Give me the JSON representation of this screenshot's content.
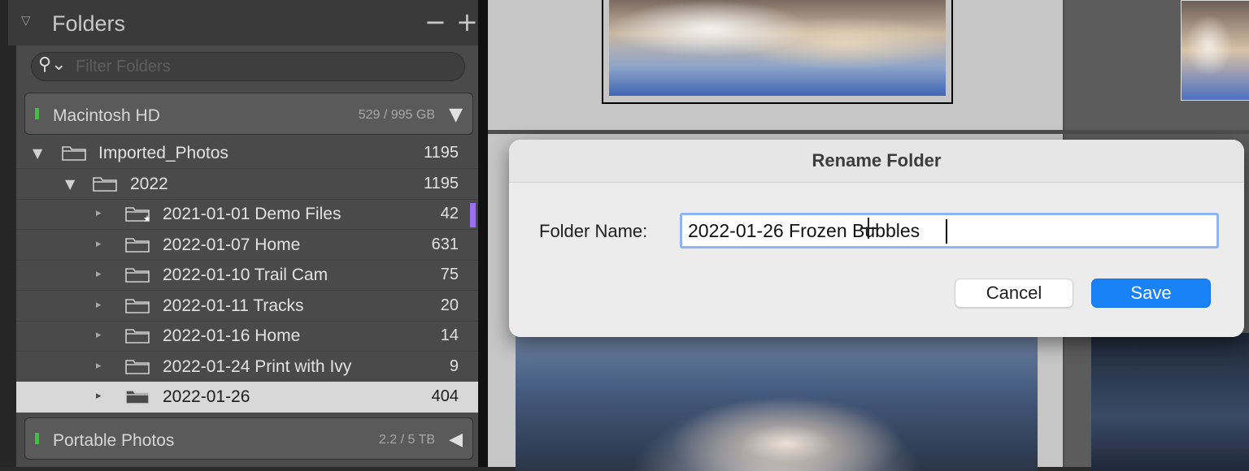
{
  "panel": {
    "title": "Folders",
    "collapse_icon": "triangle-down-icon",
    "remove_symbol": "−",
    "add_symbol": "+",
    "filter": {
      "placeholder": "Filter Folders",
      "value": ""
    }
  },
  "drives": [
    {
      "name": "Macintosh HD",
      "usage": "529 / 995 GB",
      "status_color": "#3fbf3f",
      "arrow": "▼"
    },
    {
      "name": "Portable Photos",
      "usage": "2.2 / 5 TB",
      "status_color": "#3fbf3f",
      "arrow": "◀"
    }
  ],
  "folders": [
    {
      "name": "Imported_Photos",
      "count": "1195",
      "level": 0,
      "expanded": true
    },
    {
      "name": "2022",
      "count": "1195",
      "level": 1,
      "expanded": true
    },
    {
      "name": "2021-01-01 Demo Files",
      "count": "42",
      "level": 2,
      "starred": true
    },
    {
      "name": "2022-01-07 Home",
      "count": "631",
      "level": 2
    },
    {
      "name": "2022-01-10 Trail Cam",
      "count": "75",
      "level": 2
    },
    {
      "name": "2022-01-11 Tracks",
      "count": "20",
      "level": 2
    },
    {
      "name": "2022-01-16 Home",
      "count": "14",
      "level": 2
    },
    {
      "name": "2022-01-24 Print with Ivy",
      "count": "9",
      "level": 2
    },
    {
      "name": "2022-01-26",
      "count": "404",
      "level": 2,
      "selected": true
    }
  ],
  "dialog": {
    "title": "Rename Folder",
    "field_label": "Folder Name:",
    "field_value": "2022-01-26 Frozen Bubbles",
    "cancel_label": "Cancel",
    "save_label": "Save",
    "accent_color": "#1a82f7"
  },
  "colors": {
    "selected_row": "#d8d8d8",
    "color_label": "#9a6ff0"
  }
}
